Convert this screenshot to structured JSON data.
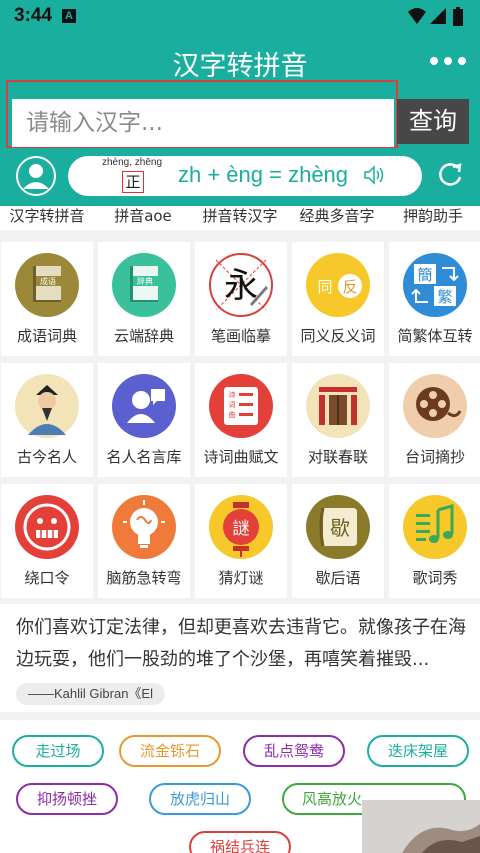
{
  "status_bar": {
    "time": "3:44",
    "notification_glyph": "A",
    "icons": [
      "wifi-icon",
      "signal-icon",
      "battery-icon"
    ]
  },
  "header": {
    "title": "汉字转拼音",
    "menu_icon": "more-dots-icon"
  },
  "search": {
    "placeholder": "请输入汉字...",
    "value": "",
    "button_label": "查询"
  },
  "pinyin_demo": {
    "small_pinyin": "zhèng, zhēng",
    "character": "正",
    "formula": "zh + èng = zhèng",
    "speaker_icon": "speaker-icon"
  },
  "top_tabs": [
    "汉字转拼音",
    "拼音aoe",
    "拼音转汉字",
    "经典多音字",
    "押韵助手"
  ],
  "grid": [
    {
      "label": "成语词典",
      "icon": "idiom-book-icon"
    },
    {
      "label": "云端辞典",
      "icon": "cloud-dictionary-icon"
    },
    {
      "label": "笔画临摹",
      "icon": "stroke-copy-icon",
      "glyph": "永"
    },
    {
      "label": "同义反义词",
      "icon": "synonym-antonym-icon",
      "glyph_a": "同",
      "glyph_b": "反"
    },
    {
      "label": "简繁体互转",
      "icon": "simplified-traditional-icon",
      "glyph_a": "簡",
      "glyph_b": "繁"
    },
    {
      "label": "古今名人",
      "icon": "famous-people-icon"
    },
    {
      "label": "名人名言库",
      "icon": "quotes-icon"
    },
    {
      "label": "诗词曲赋文",
      "icon": "poetry-icon",
      "glyph": "诗词曲"
    },
    {
      "label": "对联春联",
      "icon": "couplets-icon"
    },
    {
      "label": "台词摘抄",
      "icon": "film-reel-icon"
    },
    {
      "label": "绕口令",
      "icon": "tongue-twister-icon"
    },
    {
      "label": "脑筋急转弯",
      "icon": "brain-teaser-icon"
    },
    {
      "label": "猜灯谜",
      "icon": "lantern-riddle-icon",
      "glyph": "謎"
    },
    {
      "label": "歇后语",
      "icon": "xiehouyu-icon",
      "glyph": "歇"
    },
    {
      "label": "歌词秀",
      "icon": "lyrics-icon"
    }
  ],
  "quote": {
    "text": "你们喜欢订定法律，但却更喜欢去违背它。就像孩子在海边玩耍，他们一股劲的堆了个沙堡，再嘻笑着摧毁...",
    "author": "——Kahlil Gibran《El"
  },
  "idioms": [
    {
      "label": "走过场",
      "color": "#1aae9f"
    },
    {
      "label": "流金铄石",
      "color": "#e69a2e"
    },
    {
      "label": "乱点鸳鸯",
      "color": "#8e2ba6"
    },
    {
      "label": "迭床架屋",
      "color": "#1aae9f"
    },
    {
      "label": "抑扬顿挫",
      "color": "#8e2ba6"
    },
    {
      "label": "放虎归山",
      "color": "#3a9ad9"
    },
    {
      "label": "风高放火",
      "color": "#3fa83f"
    },
    {
      "label": "祸结兵连",
      "color": "#d9403c"
    }
  ],
  "colors": {
    "brand": "#1aae9f",
    "dark_button": "#474747",
    "highlight_border": "#d9403c"
  }
}
